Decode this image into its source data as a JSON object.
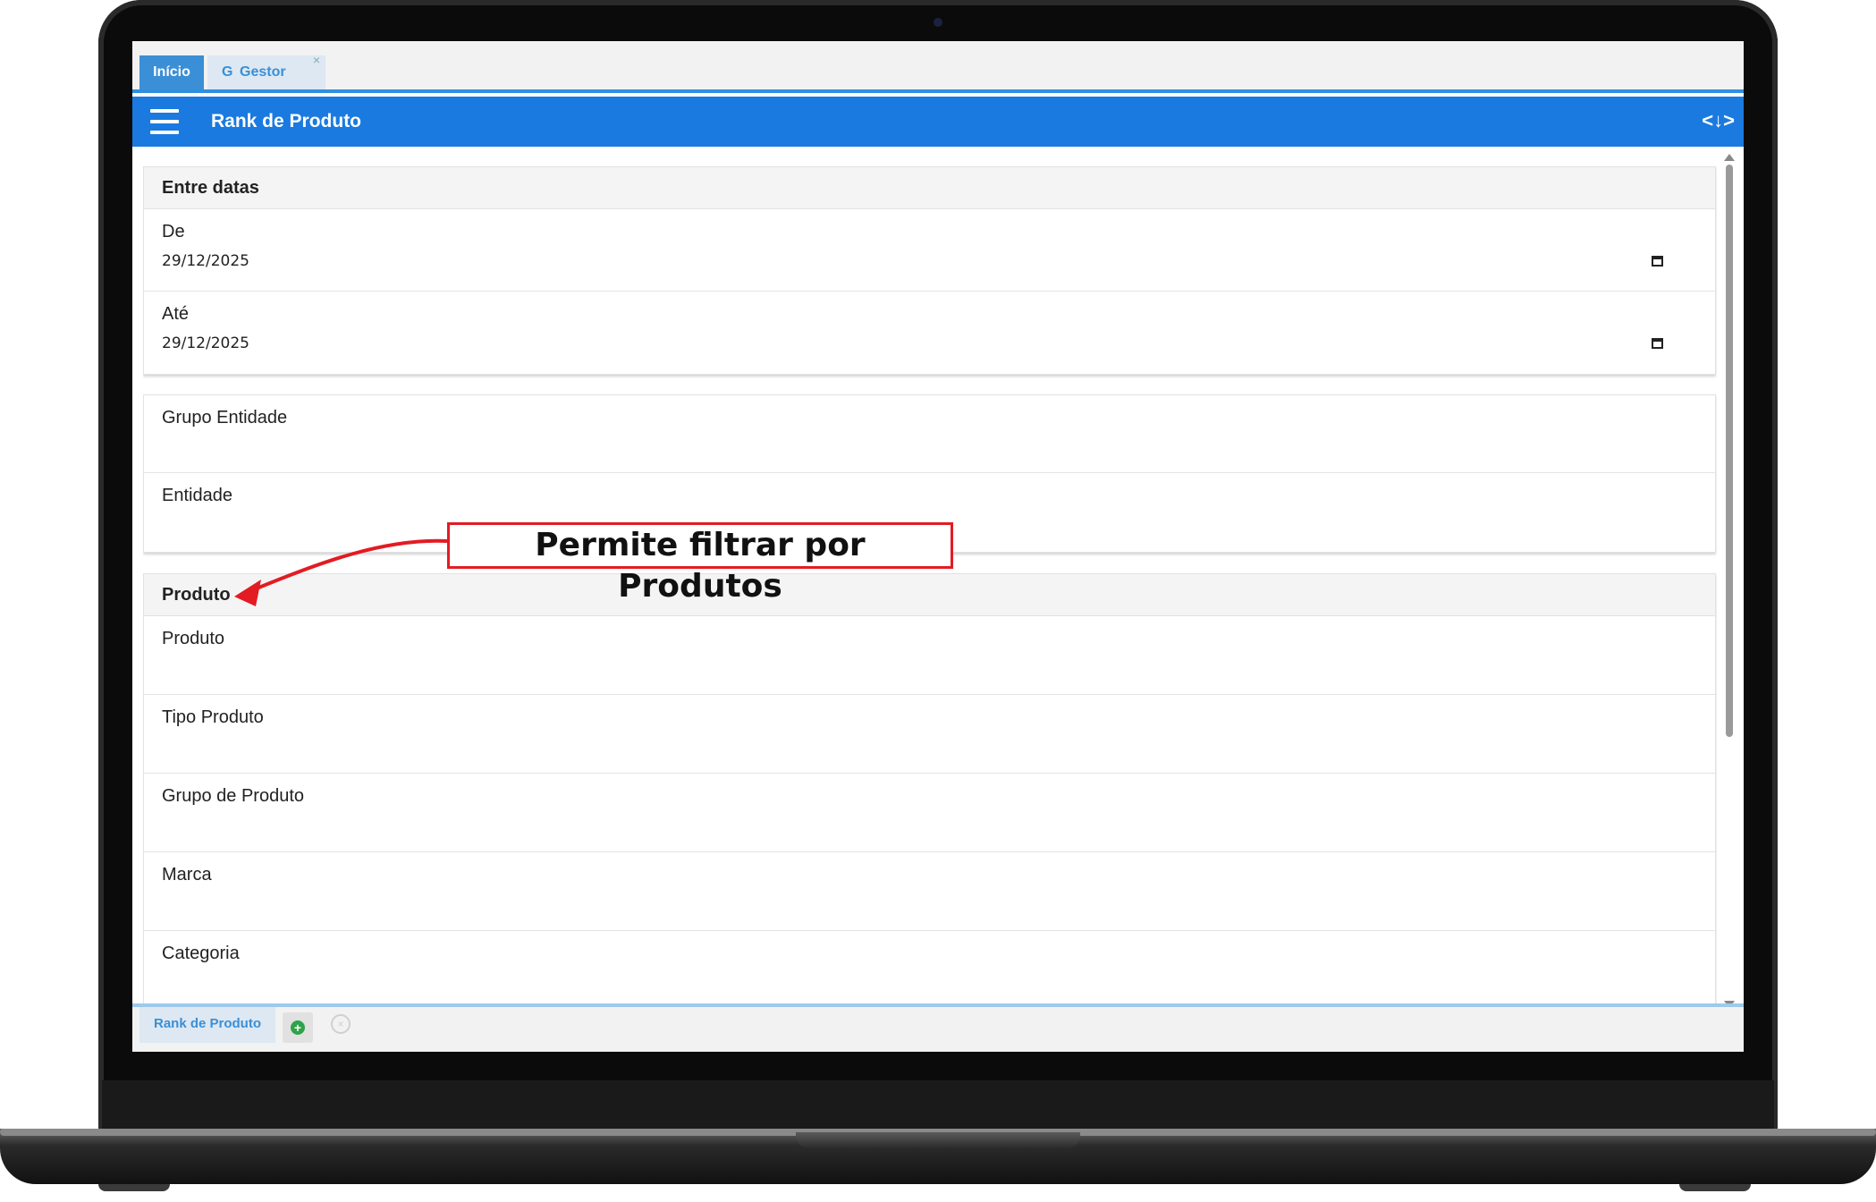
{
  "tabs": {
    "home": "Início",
    "gestor": "Gestor",
    "gestor_icon": "G",
    "close_glyph": "×"
  },
  "header": {
    "title": "Rank de Produto",
    "menu_icon": "hamburger-icon",
    "code_icon": "<↓>"
  },
  "date_section": {
    "title": "Entre datas",
    "from_label": "De",
    "from_value": "29/12/2025",
    "to_label": "Até",
    "to_value": "29/12/2025"
  },
  "entity_section": {
    "group_label": "Grupo Entidade",
    "entity_label": "Entidade"
  },
  "product_section": {
    "title": "Produto",
    "fields": [
      "Produto",
      "Tipo Produto",
      "Grupo de Produto",
      "Marca",
      "Categoria"
    ]
  },
  "bottom": {
    "tab_label": "Rank de Produto",
    "add_glyph": "+",
    "close_glyph": "×"
  },
  "annotation": {
    "text": "Permite filtrar por Produtos",
    "color": "#e31b23"
  },
  "colors": {
    "header_bg": "#1a7ae0",
    "tab_active_bg": "#3a8fd6"
  }
}
